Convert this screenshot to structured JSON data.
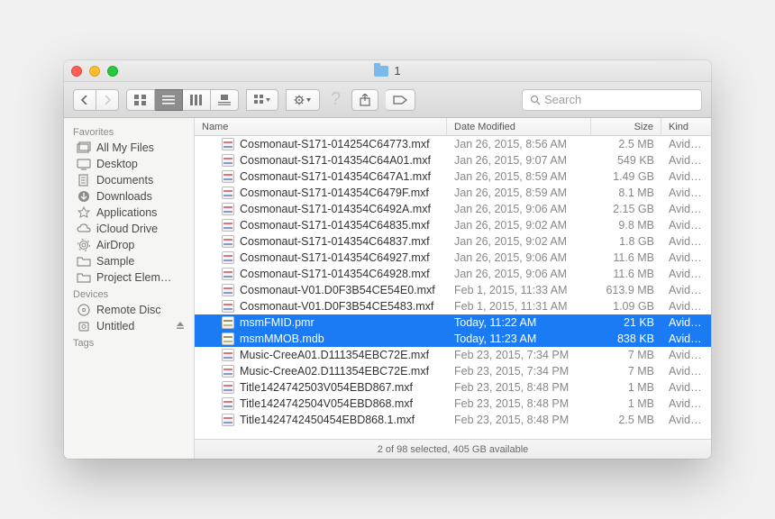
{
  "window": {
    "title": "1"
  },
  "toolbar": {
    "search_placeholder": "Search"
  },
  "sidebar": {
    "sections": [
      {
        "title": "Favorites",
        "items": [
          {
            "label": "All My Files",
            "icon": "all-my-files"
          },
          {
            "label": "Desktop",
            "icon": "desktop"
          },
          {
            "label": "Documents",
            "icon": "documents"
          },
          {
            "label": "Downloads",
            "icon": "downloads"
          },
          {
            "label": "Applications",
            "icon": "applications"
          },
          {
            "label": "iCloud Drive",
            "icon": "icloud"
          },
          {
            "label": "AirDrop",
            "icon": "airdrop"
          },
          {
            "label": "Sample",
            "icon": "folder"
          },
          {
            "label": "Project Elem…",
            "icon": "folder"
          }
        ]
      },
      {
        "title": "Devices",
        "items": [
          {
            "label": "Remote Disc",
            "icon": "remote-disc"
          },
          {
            "label": "Untitled",
            "icon": "eject-disk"
          }
        ]
      },
      {
        "title": "Tags",
        "items": []
      }
    ]
  },
  "columns": {
    "name": "Name",
    "date": "Date Modified",
    "size": "Size",
    "kind": "Kind"
  },
  "files": [
    {
      "name": "Cosmonaut-S171-014254C64773.mxf",
      "date": "Jan 26, 2015, 8:56 AM",
      "size": "2.5 MB",
      "kind": "AvidM…",
      "selected": false,
      "icon": "mxf"
    },
    {
      "name": "Cosmonaut-S171-014354C64A01.mxf",
      "date": "Jan 26, 2015, 9:07 AM",
      "size": "549 KB",
      "kind": "AvidM…",
      "selected": false,
      "icon": "mxf"
    },
    {
      "name": "Cosmonaut-S171-014354C647A1.mxf",
      "date": "Jan 26, 2015, 8:59 AM",
      "size": "1.49 GB",
      "kind": "AvidM…",
      "selected": false,
      "icon": "mxf"
    },
    {
      "name": "Cosmonaut-S171-014354C6479F.mxf",
      "date": "Jan 26, 2015, 8:59 AM",
      "size": "8.1 MB",
      "kind": "AvidM…",
      "selected": false,
      "icon": "mxf"
    },
    {
      "name": "Cosmonaut-S171-014354C6492A.mxf",
      "date": "Jan 26, 2015, 9:06 AM",
      "size": "2.15 GB",
      "kind": "AvidM…",
      "selected": false,
      "icon": "mxf"
    },
    {
      "name": "Cosmonaut-S171-014354C64835.mxf",
      "date": "Jan 26, 2015, 9:02 AM",
      "size": "9.8 MB",
      "kind": "AvidM…",
      "selected": false,
      "icon": "mxf"
    },
    {
      "name": "Cosmonaut-S171-014354C64837.mxf",
      "date": "Jan 26, 2015, 9:02 AM",
      "size": "1.8 GB",
      "kind": "AvidM…",
      "selected": false,
      "icon": "mxf"
    },
    {
      "name": "Cosmonaut-S171-014354C64927.mxf",
      "date": "Jan 26, 2015, 9:06 AM",
      "size": "11.6 MB",
      "kind": "AvidM…",
      "selected": false,
      "icon": "mxf"
    },
    {
      "name": "Cosmonaut-S171-014354C64928.mxf",
      "date": "Jan 26, 2015, 9:06 AM",
      "size": "11.6 MB",
      "kind": "AvidM…",
      "selected": false,
      "icon": "mxf"
    },
    {
      "name": "Cosmonaut-V01.D0F3B54CE54E0.mxf",
      "date": "Feb 1, 2015, 11:33 AM",
      "size": "613.9 MB",
      "kind": "AvidM…",
      "selected": false,
      "icon": "mxf"
    },
    {
      "name": "Cosmonaut-V01.D0F3B54CE5483.mxf",
      "date": "Feb 1, 2015, 11:31 AM",
      "size": "1.09 GB",
      "kind": "AvidM…",
      "selected": false,
      "icon": "mxf"
    },
    {
      "name": "msmFMID.pmr",
      "date": "Today, 11:22 AM",
      "size": "21 KB",
      "kind": "AvidM…",
      "selected": true,
      "icon": "db"
    },
    {
      "name": "msmMMOB.mdb",
      "date": "Today, 11:23 AM",
      "size": "838 KB",
      "kind": "AvidM…",
      "selected": true,
      "icon": "db"
    },
    {
      "name": "Music-CreeA01.D111354EBC72E.mxf",
      "date": "Feb 23, 2015, 7:34 PM",
      "size": "7 MB",
      "kind": "AvidM…",
      "selected": false,
      "icon": "mxf"
    },
    {
      "name": "Music-CreeA02.D111354EBC72E.mxf",
      "date": "Feb 23, 2015, 7:34 PM",
      "size": "7 MB",
      "kind": "AvidM…",
      "selected": false,
      "icon": "mxf"
    },
    {
      "name": "Title1424742503V054EBD867.mxf",
      "date": "Feb 23, 2015, 8:48 PM",
      "size": "1 MB",
      "kind": "AvidM…",
      "selected": false,
      "icon": "mxf"
    },
    {
      "name": "Title1424742504V054EBD868.mxf",
      "date": "Feb 23, 2015, 8:48 PM",
      "size": "1 MB",
      "kind": "AvidM…",
      "selected": false,
      "icon": "mxf"
    },
    {
      "name": "Title1424742450454EBD868.1.mxf",
      "date": "Feb 23, 2015, 8:48 PM",
      "size": "2.5 MB",
      "kind": "AvidM…",
      "selected": false,
      "icon": "mxf"
    }
  ],
  "status": "2 of 98 selected, 405 GB available"
}
